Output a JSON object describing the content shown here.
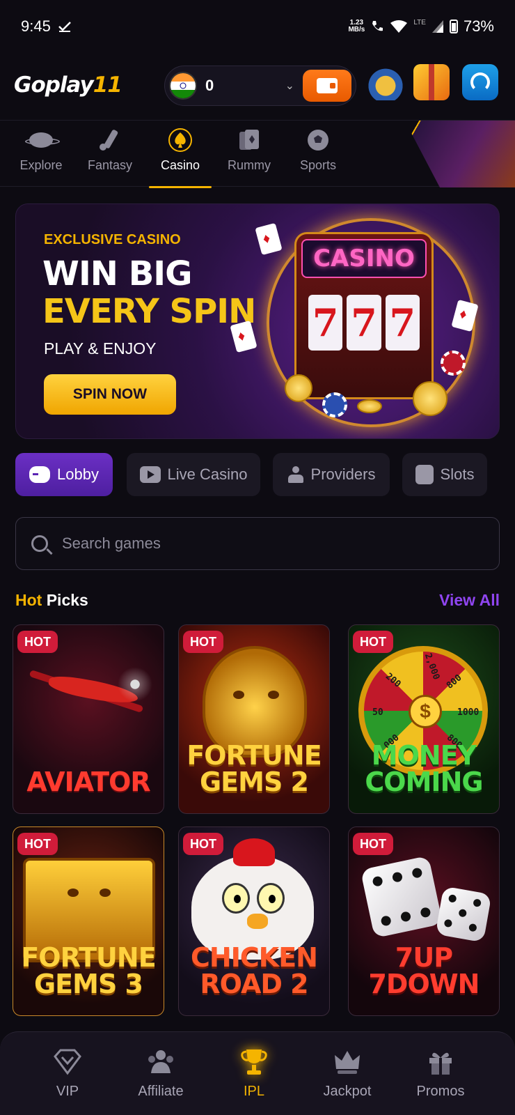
{
  "status_bar": {
    "time": "9:45",
    "net_speed": "1.23",
    "net_unit": "MB/s",
    "network": "LTE",
    "battery": "73%"
  },
  "header": {
    "logo_main": "Goplay",
    "logo_num": "11",
    "wallet_balance": "0",
    "icons": [
      "wallet-icon",
      "treasure-pot-icon",
      "gift-box-icon",
      "support-icon"
    ]
  },
  "categories": [
    {
      "label": "Explore",
      "icon": "planet-icon"
    },
    {
      "label": "Fantasy",
      "icon": "cricket-bat-icon"
    },
    {
      "label": "Casino",
      "icon": "spade-icon",
      "active": true
    },
    {
      "label": "Rummy",
      "icon": "cards-icon"
    },
    {
      "label": "Sports",
      "icon": "football-icon"
    }
  ],
  "hero": {
    "kicker": "EXCLUSIVE CASINO",
    "line1": "WIN BIG",
    "line2": "EVERY SPIN",
    "sub": "PLAY & ENJOY",
    "cta": "SPIN NOW",
    "sign": "CASINO",
    "reels": [
      "7",
      "7",
      "7"
    ]
  },
  "subtabs": [
    {
      "label": "Lobby",
      "active": true
    },
    {
      "label": "Live Casino"
    },
    {
      "label": "Providers"
    },
    {
      "label": "Slots"
    }
  ],
  "search": {
    "placeholder": "Search games"
  },
  "hot_picks": {
    "title_accent": "Hot",
    "title_rest": " Picks",
    "view_all": "View All",
    "badge": "HOT",
    "games": [
      {
        "name": "AVIATOR"
      },
      {
        "name": "FORTUNE\nGEMS 2"
      },
      {
        "name": "MONEY\nCOMING",
        "wheel_labels": [
          "2,000",
          "200",
          "50",
          "000",
          "800",
          "1000",
          "800"
        ]
      },
      {
        "name": "FORTUNE\nGEMS 3"
      },
      {
        "name": "CHICKEN\nROAD 2"
      },
      {
        "name": "7UP\n7DOWN"
      }
    ]
  },
  "bottom_nav": [
    {
      "label": "VIP",
      "icon": "diamond-icon"
    },
    {
      "label": "Affiliate",
      "icon": "group-icon"
    },
    {
      "label": "IPL",
      "icon": "trophy-icon",
      "active": true
    },
    {
      "label": "Jackpot",
      "icon": "crown-icon"
    },
    {
      "label": "Promos",
      "icon": "gift-icon"
    }
  ],
  "colors": {
    "accent": "#f5b400",
    "primary": "#6b2fc4",
    "background": "#0d0b12",
    "hot_badge": "#d01c3a",
    "view_all": "#8f45f0"
  }
}
